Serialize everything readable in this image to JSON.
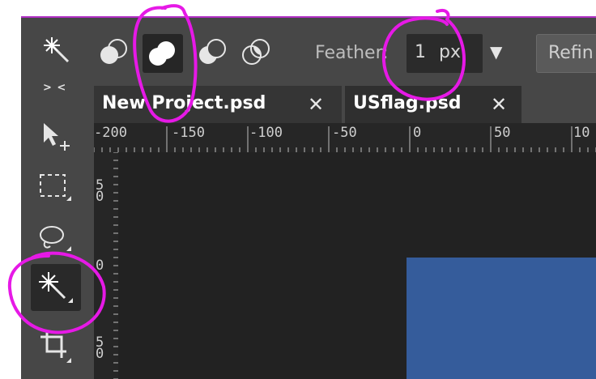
{
  "options_bar": {
    "mode_icons": [
      "magic-wand-icon",
      "new-selection-icon",
      "add-to-selection-icon",
      "subtract-from-selection-icon",
      "intersect-selection-icon"
    ],
    "feather_label": "Feather:",
    "feather_value": "1",
    "feather_unit": "px",
    "dropdown_glyph": "▼",
    "refine_label": "Refin"
  },
  "toolbar": {
    "collapse_label": "> <",
    "tools": [
      "move-tool-icon",
      "rectangular-marquee-icon",
      "lasso-icon",
      "magic-wand-icon",
      "crop-icon"
    ]
  },
  "tabs": [
    {
      "label": "New Project.psd",
      "close": "✕"
    },
    {
      "label": "USflag.psd",
      "close": "✕"
    }
  ],
  "ruler": {
    "horizontal": [
      "-200",
      "-150",
      "-100",
      "-50",
      "0",
      "50",
      "10"
    ],
    "vertical": [
      "5\n0",
      "0",
      "5\n0"
    ]
  },
  "colors": {
    "panel": "#474747",
    "canvas": "#222222",
    "flag_blue": "#355c9b",
    "annotation": "#e619e6"
  }
}
